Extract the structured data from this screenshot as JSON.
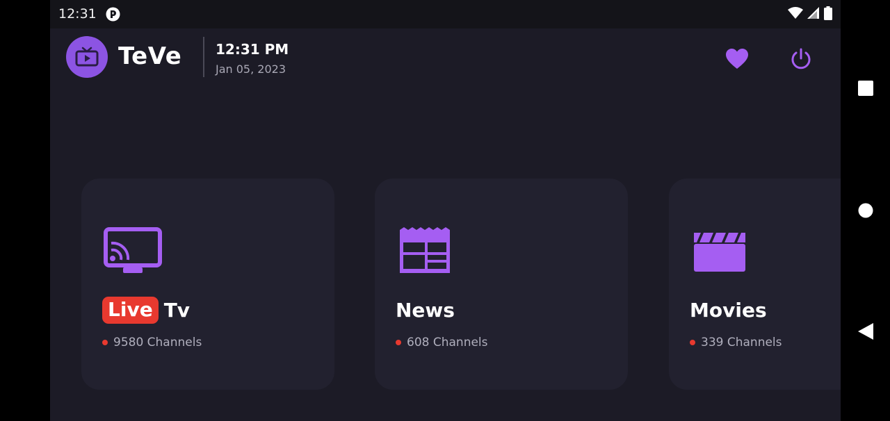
{
  "status_bar": {
    "time": "12:31",
    "icons": [
      "app-notification-icon",
      "wifi-icon",
      "signal-icon",
      "battery-icon"
    ]
  },
  "header": {
    "app_name": "TeVe",
    "time": "12:31 PM",
    "date": "Jan 05, 2023",
    "icons": [
      "tv-logo-icon",
      "heart-icon",
      "power-icon"
    ]
  },
  "categories": [
    {
      "badge": "Live",
      "title": "Tv",
      "subtitle": "9580 Channels",
      "icon": "cast-tv-icon"
    },
    {
      "title": "News",
      "subtitle": "608 Channels",
      "icon": "newspaper-icon"
    },
    {
      "title": "Movies",
      "subtitle": "339 Channels",
      "icon": "clapperboard-icon"
    }
  ],
  "nav_bar": {
    "icons": [
      "recents-square-icon",
      "home-circle-icon",
      "back-triangle-icon"
    ]
  },
  "colors": {
    "accent": "#a55ef2",
    "background": "#1c1b26",
    "card": "#22212f",
    "live_red": "#e8392f"
  }
}
